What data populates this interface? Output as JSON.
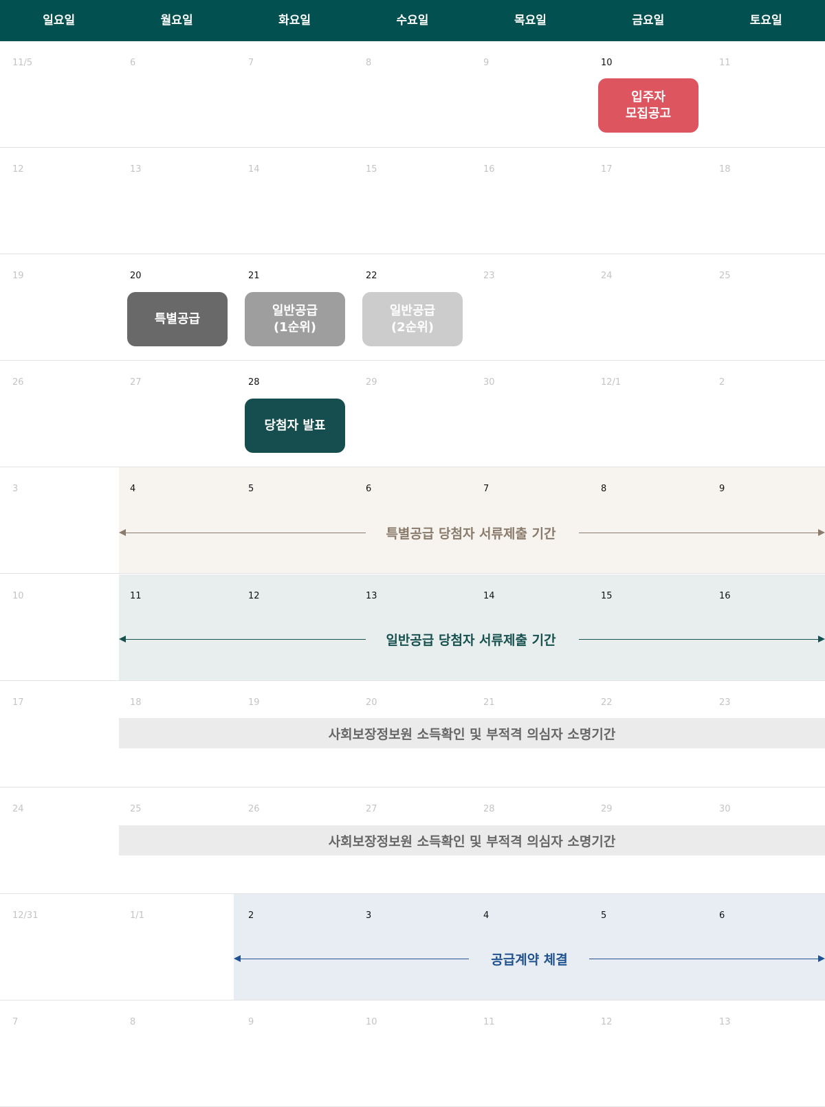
{
  "header": {
    "days": [
      "일요일",
      "월요일",
      "화요일",
      "수요일",
      "목요일",
      "금요일",
      "토요일"
    ]
  },
  "colors": {
    "header_bg": "#02504f",
    "recruit_event": "#dc555f",
    "special_supply_event": "#696969",
    "general_first_event": "#9e9e9e",
    "general_second_event": "#cccccc",
    "winner_event": "#164e4f",
    "special_docs_bg": "#f7f4f0",
    "special_docs_text": "#8a7b6c",
    "general_docs_bg": "#e8eded",
    "general_docs_text": "#16504f",
    "income_check_bg": "#ebebeb",
    "contract_bg": "#e8edf3",
    "contract_text": "#1f528f"
  },
  "weeks": [
    {
      "days": [
        "11/5",
        "6",
        "7",
        "8",
        "9",
        "10",
        "11"
      ],
      "active": [
        5
      ]
    },
    {
      "days": [
        "12",
        "13",
        "14",
        "15",
        "16",
        "17",
        "18"
      ],
      "active": []
    },
    {
      "days": [
        "19",
        "20",
        "21",
        "22",
        "23",
        "24",
        "25"
      ],
      "active": [
        1,
        2,
        3
      ]
    },
    {
      "days": [
        "26",
        "27",
        "28",
        "29",
        "30",
        "12/1",
        "2"
      ],
      "active": [
        2
      ]
    },
    {
      "days": [
        "3",
        "4",
        "5",
        "6",
        "7",
        "8",
        "9"
      ],
      "active": [
        1,
        2,
        3,
        4,
        5,
        6
      ]
    },
    {
      "days": [
        "10",
        "11",
        "12",
        "13",
        "14",
        "15",
        "16"
      ],
      "active": [
        1,
        2,
        3,
        4,
        5,
        6
      ]
    },
    {
      "days": [
        "17",
        "18",
        "19",
        "20",
        "21",
        "22",
        "23"
      ],
      "active": []
    },
    {
      "days": [
        "24",
        "25",
        "26",
        "27",
        "28",
        "29",
        "30"
      ],
      "active": []
    },
    {
      "days": [
        "12/31",
        "1/1",
        "2",
        "3",
        "4",
        "5",
        "6"
      ],
      "active": [
        2,
        3,
        4,
        5,
        6
      ]
    },
    {
      "days": [
        "7",
        "8",
        "9",
        "10",
        "11",
        "12",
        "13"
      ],
      "active": []
    }
  ],
  "events": {
    "recruit": "입주자\n모집공고",
    "special_supply": "특별공급",
    "general_first": "일반공급\n(1순위)",
    "general_second": "일반공급\n(2순위)",
    "winner_announce": "당첨자 발표"
  },
  "ranges": {
    "special_docs": "특별공급 당첨자 서류제출 기간",
    "general_docs": "일반공급 당첨자 서류제출 기간",
    "income_check_1": "사회보장정보원 소득확인 및 부적격 의심자 소명기간",
    "income_check_2": "사회보장정보원 소득확인 및 부적격 의심자 소명기간",
    "contract": "공급계약 체결"
  }
}
